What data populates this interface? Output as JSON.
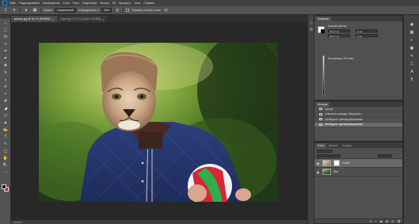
{
  "menubar": {
    "logo": "Ps",
    "items": [
      "Файл",
      "Редактирование",
      "Изображение",
      "Слои",
      "Текст",
      "Выделение",
      "Фильтр",
      "3D",
      "Просмотр",
      "Окно",
      "Справка"
    ]
  },
  "options": {
    "mode_label": "Режим:",
    "mode_value": "Нормальный",
    "opacity_label": "Непрозрачность:",
    "opacity_value": "50%",
    "sample_label": "Образец со всех слоев"
  },
  "document_tabs": [
    {
      "label": "малыш.jpg @ 16,7% (RGB/8#)",
      "close": "×"
    },
    {
      "label": "Переход © 11,70 (Слой 0, RGB/8)",
      "close": "×"
    }
  ],
  "status_bar": "16,67%",
  "properties": {
    "tabs": [
      "Свойства"
    ],
    "layer_type": "Заливка цветом",
    "field_a": "46,32 см",
    "field_b": "54,27 см",
    "field_c": "0 см",
    "field_d": "0 см",
    "field_label": "Растушевка: 300 пикс."
  },
  "history": {
    "tabs": [
      "История"
    ],
    "items": [
      {
        "label": "Листья",
        "selected": false
      },
      {
        "label": "Отменить команду «Загрузить»",
        "selected": false
      },
      {
        "label": "Свободное трансформирование",
        "selected": false
      },
      {
        "label": "Свободное трансформирование",
        "selected": true
      }
    ]
  },
  "layers": {
    "tabs": [
      "Слои",
      "Каналы",
      "Контуры"
    ],
    "rows": [
      {
        "name": "Слой 1",
        "selected": true
      },
      {
        "name": "Фон",
        "selected": false
      }
    ],
    "footer_icons": [
      "fx",
      "◐",
      "▣",
      "▤",
      "⊞",
      "🗑"
    ]
  },
  "tools": [
    "↔",
    "⬚",
    "ʘ",
    "✧",
    "⌗",
    "✒",
    "✚",
    "✎",
    "⌕",
    "✐",
    "◓",
    "✜",
    "◢",
    "▭",
    "▲",
    "✍",
    "T",
    "↖",
    "◻",
    "✋",
    "🔍",
    "⋯"
  ]
}
